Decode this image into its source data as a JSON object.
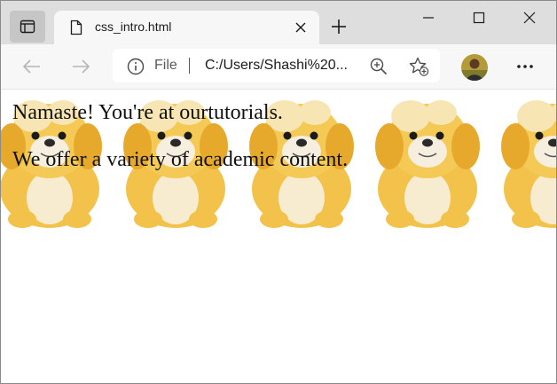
{
  "tab": {
    "title": "css_intro.html"
  },
  "address_bar": {
    "scheme_label": "File",
    "url": "C:/Users/Shashi%20..."
  },
  "page": {
    "paragraphs": [
      "Namaste! You're at ourtutorials.",
      "We offer a variety of academic content."
    ],
    "background_image": "plush-puppy-toy",
    "background_repeat": "repeat-x"
  },
  "icons": {
    "tab_actions": "tab-actions-icon",
    "page": "page-icon",
    "close_tab": "close-icon",
    "new_tab": "plus-icon",
    "minimize": "minimize-icon",
    "maximize": "maximize-icon",
    "close_window": "close-icon",
    "back": "arrow-left-icon",
    "forward": "arrow-right-icon",
    "site_info": "info-icon",
    "zoom": "zoom-in-icon",
    "favorites": "add-favorite-icon",
    "profile": "avatar",
    "more": "more-icon"
  },
  "colors": {
    "tabstrip_bg": "#dedede",
    "toolbar_bg": "#f7f7f7",
    "puppy_fur": "#f2c24a",
    "puppy_cream": "#f7ecd0"
  }
}
